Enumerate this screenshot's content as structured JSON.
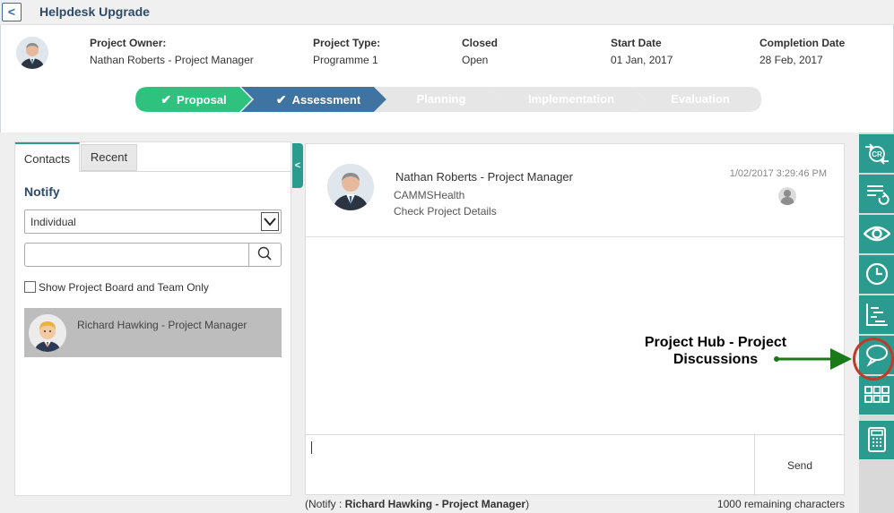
{
  "header": {
    "back_label": "<",
    "title": "Helpdesk Upgrade"
  },
  "project": {
    "owner_label": "Project Owner:",
    "owner_value": "Nathan Roberts - Project Manager",
    "type_label": "Project Type:",
    "type_value": "Programme 1",
    "status_label": "Closed",
    "status_value": "Open",
    "start_label": "Start Date",
    "start_value": "01 Jan, 2017",
    "completion_label": "Completion Date",
    "completion_value": "28 Feb, 2017"
  },
  "stages": [
    {
      "label": "Proposal",
      "state": "done",
      "check": "✔"
    },
    {
      "label": "Assessment",
      "state": "current",
      "check": "✔"
    },
    {
      "label": "Planning",
      "state": "pending"
    },
    {
      "label": "Implementation",
      "state": "pending"
    },
    {
      "label": "Evaluation",
      "state": "pending"
    }
  ],
  "contacts_panel": {
    "tabs": [
      "Contacts",
      "Recent"
    ],
    "notify_title": "Notify",
    "select_value": "Individual",
    "search_placeholder": "",
    "checkbox_label": "Show Project Board and Team Only",
    "contacts": [
      {
        "name": "Richard Hawking - Project Manager"
      }
    ]
  },
  "collapse_label": "<",
  "discussion": {
    "message": {
      "author": "Nathan Roberts - Project Manager",
      "org": "CAMMSHealth",
      "text": "Check Project Details",
      "time": "1/02/2017 3:29:46 PM"
    },
    "send_label": "Send",
    "notify_prefix": "(Notify : ",
    "notify_name": "Richard Hawking - Project Manager",
    "notify_suffix": ")",
    "remaining": "1000 remaining characters"
  },
  "toolbar": {
    "items": [
      "change-request-icon",
      "list-refresh-icon",
      "eye-icon",
      "clock-icon",
      "gantt-icon",
      "chat-bubble-icon",
      "grid-icon",
      "calculator-icon"
    ],
    "accent": "#2b9a8f"
  },
  "annotation": {
    "line1": "Project Hub - Project",
    "line2": "Discussions"
  },
  "colors": {
    "stage_done": "#2ec27e",
    "stage_current": "#3f73a0",
    "stage_pending": "#e8e8e8",
    "teal": "#2b9a8f",
    "arrow": "#1a7a1a"
  }
}
